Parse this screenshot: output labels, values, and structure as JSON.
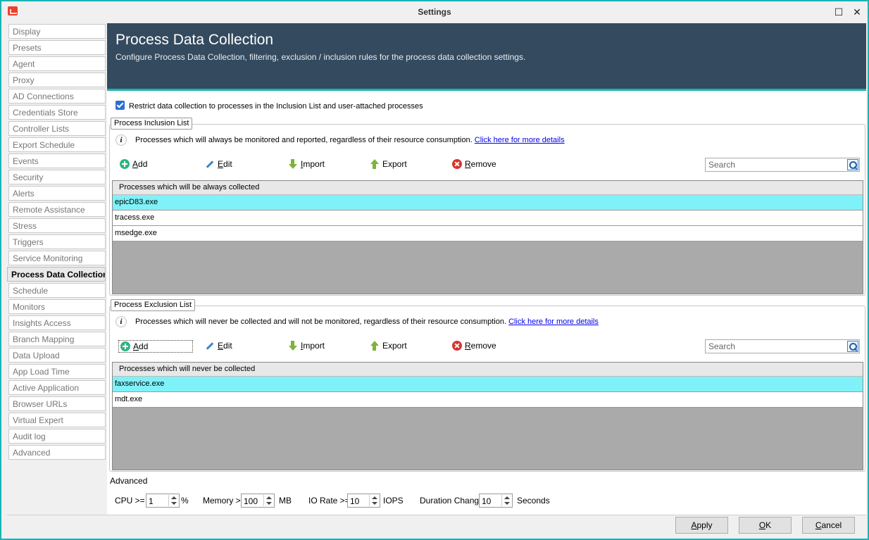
{
  "window": {
    "title": "Settings",
    "maximize_glyph": "☐",
    "close_glyph": "✕"
  },
  "sidebar": {
    "items": [
      {
        "label": "Display"
      },
      {
        "label": "Presets"
      },
      {
        "label": "Agent"
      },
      {
        "label": "Proxy"
      },
      {
        "label": "AD Connections"
      },
      {
        "label": "Credentials Store"
      },
      {
        "label": "Controller Lists"
      },
      {
        "label": "Export Schedule"
      },
      {
        "label": "Events"
      },
      {
        "label": "Security"
      },
      {
        "label": "Alerts"
      },
      {
        "label": "Remote Assistance"
      },
      {
        "label": "Stress"
      },
      {
        "label": "Triggers"
      },
      {
        "label": "Service Monitoring"
      },
      {
        "label": "Process Data Collection",
        "active": true
      },
      {
        "label": "Schedule"
      },
      {
        "label": "Monitors"
      },
      {
        "label": "Insights Access"
      },
      {
        "label": "Branch Mapping"
      },
      {
        "label": "Data Upload"
      },
      {
        "label": "App Load Time"
      },
      {
        "label": "Active Application"
      },
      {
        "label": "Browser URLs"
      },
      {
        "label": "Virtual Expert"
      },
      {
        "label": "Audit log"
      },
      {
        "label": "Advanced"
      }
    ]
  },
  "header": {
    "title": "Process Data Collection",
    "subtitle": "Configure Process Data Collection, filtering, exclusion / inclusion rules for the process data collection settings."
  },
  "restrict": {
    "checked": true,
    "label": "Restrict data collection to processes in the Inclusion List and user-attached processes"
  },
  "inclusion": {
    "group_label": "Process Inclusion List",
    "info_text": "Processes which will always be monitored and reported, regardless of their resource consumption.",
    "link_text": "Click here for more details",
    "toolbar": {
      "add_k": "A",
      "add_rest": "dd",
      "edit_k": "E",
      "edit_rest": "dit",
      "import_k": "I",
      "import_rest": "mport",
      "export": "Export",
      "remove_k": "R",
      "remove_rest": "emove"
    },
    "search_placeholder": "Search",
    "column_header": "Processes which will be always collected",
    "rows": [
      "epicD83.exe",
      "tracess.exe",
      "msedge.exe"
    ],
    "selected_index": 0
  },
  "exclusion": {
    "group_label": "Process Exclusion List",
    "info_text": "Processes which will never be collected and will not be monitored, regardless of their resource consumption.",
    "link_text": "Click here for more details",
    "toolbar": {
      "add_k": "A",
      "add_rest": "dd",
      "edit_k": "E",
      "edit_rest": "dit",
      "import_k": "I",
      "import_rest": "mport",
      "export": "Export",
      "remove_k": "R",
      "remove_rest": "emove"
    },
    "search_placeholder": "Search",
    "column_header": "Processes which will never be collected",
    "rows": [
      "faxservice.exe",
      "mdt.exe"
    ],
    "selected_index": 0
  },
  "advanced": {
    "title": "Advanced",
    "cpu_label": "CPU >=",
    "cpu_value": "1",
    "cpu_unit": "%",
    "memory_label": "Memory >=",
    "memory_value": "100",
    "memory_unit": "MB",
    "io_label": "IO Rate >=",
    "io_value": "10",
    "io_unit": "IOPS",
    "duration_label": "Duration Change",
    "duration_value": "10",
    "duration_unit": "Seconds"
  },
  "footer": {
    "apply_k": "A",
    "apply_rest": "pply",
    "ok_k": "O",
    "ok_rest": "K",
    "cancel_k": "C",
    "cancel_rest": "ancel"
  }
}
